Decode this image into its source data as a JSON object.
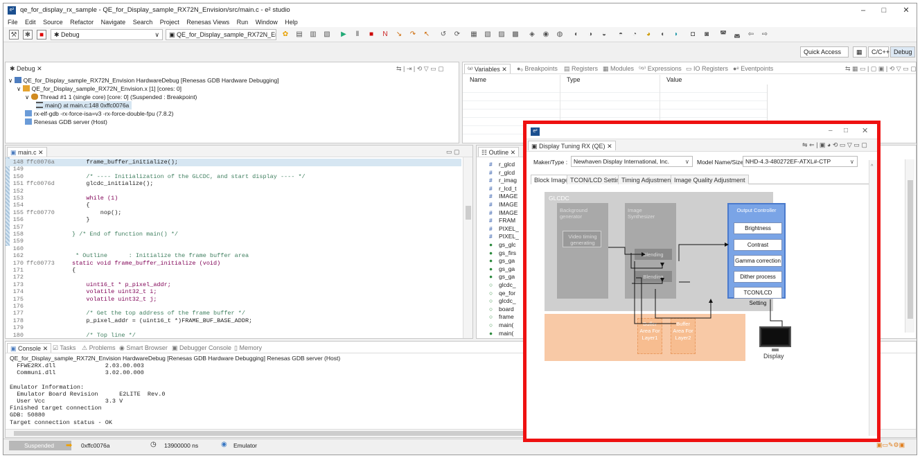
{
  "window": {
    "title": "qe_for_display_rx_sample - QE_for_Display_sample_RX72N_Envision/src/main.c - e² studio",
    "minimize": "–",
    "maximize": "□",
    "close": "✕"
  },
  "menu": [
    "File",
    "Edit",
    "Source",
    "Refactor",
    "Navigate",
    "Search",
    "Project",
    "Renesas Views",
    "Run",
    "Window",
    "Help"
  ],
  "toolbar": {
    "launch_mode": "Debug",
    "launch_config": "QE_for_Display_sample_RX72N_En",
    "quick_access": "Quick Access",
    "perspective_cpp": "C/C++",
    "perspective_debug": "Debug"
  },
  "debug_view": {
    "tab": "Debug",
    "items": [
      "QE_for_Display_sample_RX72N_Envision HardwareDebug [Renesas GDB Hardware Debugging]",
      "QE_for_Display_sample_RX72N_Envision.x [1] [cores: 0]",
      "Thread #1 1 (single core) [core: 0] (Suspended : Breakpoint)",
      "main() at main.c:148 0xffc0076a",
      "rx-elf-gdb -rx-force-isa=v3 -rx-force-double-fpu (7.8.2)",
      "Renesas GDB server (Host)"
    ]
  },
  "variables_view": {
    "tabs": [
      "Variables",
      "Breakpoints",
      "Registers",
      "Modules",
      "Expressions",
      "IO Registers",
      "Eventpoints"
    ],
    "columns": [
      "Name",
      "Type",
      "Value"
    ]
  },
  "editor": {
    "tab": "main.c",
    "lines": [
      {
        "num": "148",
        "addr": "ffc0076a",
        "code": "    frame_buffer_initialize();"
      },
      {
        "num": "149",
        "addr": "",
        "code": ""
      },
      {
        "num": "150",
        "addr": "",
        "code": "    /* ---- Initialization of the GLCDC, and start display ---- */"
      },
      {
        "num": "151",
        "addr": "ffc0076d",
        "code": "    glcdc_initialize();"
      },
      {
        "num": "152",
        "addr": "",
        "code": ""
      },
      {
        "num": "153",
        "addr": "",
        "code": "    while (1)"
      },
      {
        "num": "154",
        "addr": "",
        "code": "    {"
      },
      {
        "num": "155",
        "addr": "ffc00770",
        "code": "        nop();"
      },
      {
        "num": "156",
        "addr": "",
        "code": "    }"
      },
      {
        "num": "157",
        "addr": "",
        "code": ""
      },
      {
        "num": "158",
        "addr": "",
        "code": "} /* End of function main() */"
      },
      {
        "num": "159",
        "addr": "",
        "code": ""
      },
      {
        "num": "160",
        "addr": "",
        "code": ""
      },
      {
        "num": "162",
        "addr": "",
        "code": " * Outline      : Initialize the frame buffer area"
      },
      {
        "num": "170",
        "addr": "ffc00773",
        "code": "static void frame_buffer_initialize (void)"
      },
      {
        "num": "171",
        "addr": "",
        "code": "{"
      },
      {
        "num": "172",
        "addr": "",
        "code": ""
      },
      {
        "num": "173",
        "addr": "",
        "code": "    uint16_t * p_pixel_addr;"
      },
      {
        "num": "174",
        "addr": "",
        "code": "    volatile uint32_t i;"
      },
      {
        "num": "175",
        "addr": "",
        "code": "    volatile uint32_t j;"
      },
      {
        "num": "176",
        "addr": "",
        "code": ""
      },
      {
        "num": "177",
        "addr": "",
        "code": "    /* Get the top address of the frame buffer */"
      },
      {
        "num": "178",
        "addr": "",
        "code": "    p_pixel_addr = (uint16_t *)FRAME_BUF_BASE_ADDR;"
      },
      {
        "num": "179",
        "addr": "",
        "code": ""
      },
      {
        "num": "180",
        "addr": "",
        "code": "    /* Top line */"
      }
    ]
  },
  "outline": {
    "tab": "Outline",
    "items": [
      {
        "icon": "#",
        "label": "r_glcd"
      },
      {
        "icon": "#",
        "label": "r_glcd"
      },
      {
        "icon": "#",
        "label": "r_imag"
      },
      {
        "icon": "#",
        "label": "r_lcd_t"
      },
      {
        "icon": "#",
        "label": "IMAGE"
      },
      {
        "icon": "#",
        "label": "IMAGE"
      },
      {
        "icon": "#",
        "label": "IMAGE"
      },
      {
        "icon": "#",
        "label": "FRAM"
      },
      {
        "icon": "#",
        "label": "PIXEL_"
      },
      {
        "icon": "#",
        "label": "PIXEL_"
      },
      {
        "icon": "●",
        "label": "gs_glc"
      },
      {
        "icon": "●",
        "label": "gs_firs"
      },
      {
        "icon": "●",
        "label": "gs_ga"
      },
      {
        "icon": "●",
        "label": "gs_ga"
      },
      {
        "icon": "●",
        "label": "gs_ga"
      },
      {
        "icon": "○",
        "label": "glcdc_"
      },
      {
        "icon": "○",
        "label": "qe_for"
      },
      {
        "icon": "○",
        "label": "glcdc_"
      },
      {
        "icon": "○",
        "label": "board"
      },
      {
        "icon": "○",
        "label": "frame"
      },
      {
        "icon": "○",
        "label": "main("
      },
      {
        "icon": "●",
        "label": "main("
      }
    ]
  },
  "console": {
    "tabs": [
      "Console",
      "Tasks",
      "Problems",
      "Smart Browser",
      "Debugger Console",
      "Memory"
    ],
    "header": "QE_for_Display_sample_RX72N_Envision HardwareDebug [Renesas GDB Hardware Debugging] Renesas GDB server (Host)",
    "lines": [
      "  FFWE2RX.dll              2.03.00.003",
      "  Communi.dll              3.02.00.000",
      "",
      "Emulator Information:",
      "  Emulator Board Revision      E2LITE  Rev.0",
      "  User Vcc                 3.3 V",
      "Finished target connection",
      "GDB: 50880",
      "Target connection status - OK"
    ]
  },
  "status": {
    "state": "Suspended",
    "address": "0xffc0076a",
    "time": "13900000 ns",
    "target": "Emulator"
  },
  "dialog": {
    "view_title": "Display Tuning RX (QE)",
    "maker_label": "Maker/Type :",
    "maker_value": "Newhaven Display International, Inc.",
    "model_label": "Model Name/Size :",
    "model_value": "NHD-4.3-480272EF-ATXL#-CTP",
    "tabs": [
      "Block Image",
      "TCON/LCD Setting",
      "Timing Adjustment",
      "Image Quality Adjustment"
    ],
    "diagram": {
      "glcdc": "GLCDC",
      "background": "Background generator",
      "video_timing": "Video timing generating",
      "synth": "Image Synthesizer",
      "blend1": "Blending",
      "blend2": "Blending",
      "output": "Output Controller",
      "buttons": [
        "Brightness",
        "Contrast",
        "Gamma correction",
        "Dither process",
        "TCON/LCD Setting"
      ],
      "buffer1": "Buffer Area For Layer1",
      "buffer2": "Buffer Area For Layer2",
      "display": "Display"
    }
  }
}
